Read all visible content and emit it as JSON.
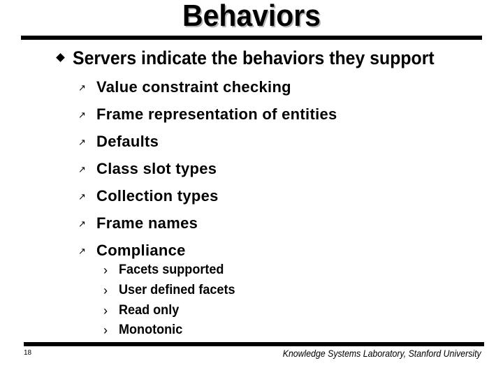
{
  "slide": {
    "title": "Behaviors",
    "main_point": {
      "bullet_icon": "diamond-bullet",
      "text": "Servers indicate the behaviors they support"
    },
    "sub_points": [
      {
        "bullet": "↗",
        "text": "Value constraint checking"
      },
      {
        "bullet": "↗",
        "text": "Frame representation of entities"
      },
      {
        "bullet": "↗",
        "text": "Defaults"
      },
      {
        "bullet": "↗",
        "text": "Class slot types"
      },
      {
        "bullet": "↗",
        "text": "Collection types"
      },
      {
        "bullet": "↗",
        "text": "Frame names"
      },
      {
        "bullet": "↗",
        "text": "Compliance"
      }
    ],
    "compliance_items": [
      {
        "bullet": "›",
        "text": "Facets supported"
      },
      {
        "bullet": "›",
        "text": "User defined facets"
      },
      {
        "bullet": "›",
        "text": "Read only"
      },
      {
        "bullet": "›",
        "text": "Monotonic"
      }
    ]
  },
  "footer": {
    "page_number": "18",
    "organization": "Knowledge Systems Laboratory, Stanford University"
  }
}
